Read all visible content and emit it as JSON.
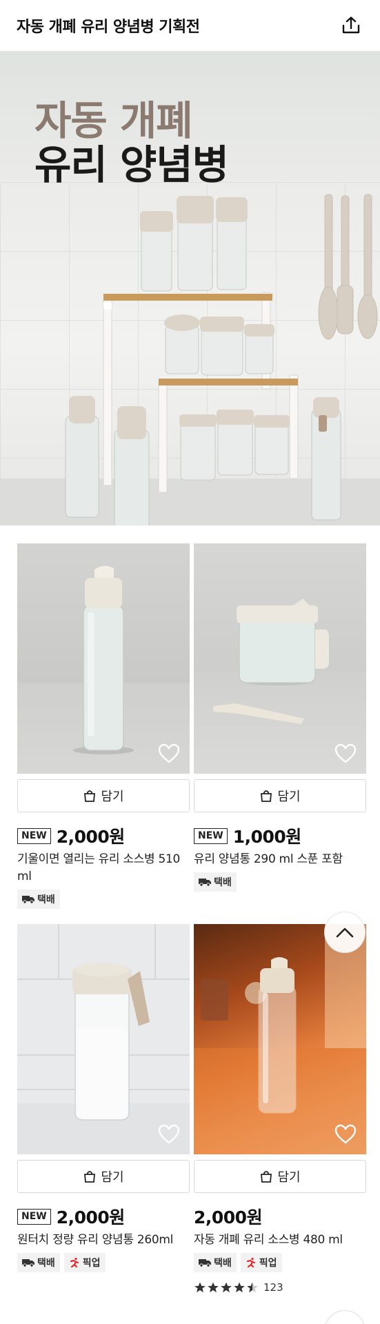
{
  "header": {
    "title": "자동 개폐 유리 양념병 기획전"
  },
  "hero": {
    "line1": "자동 개폐",
    "line2": "유리 양념병"
  },
  "labels": {
    "cart": "담기",
    "new": "NEW",
    "delivery": "택배",
    "pickup": "픽업"
  },
  "products": [
    {
      "price": "2,000원",
      "name": "기울이면 열리는 유리 소스병 510 ml",
      "is_new": true,
      "tags": [
        "택배"
      ]
    },
    {
      "price": "1,000원",
      "name": "유리 양념통 290 ml 스푼 포함",
      "is_new": true,
      "tags": [
        "택배"
      ]
    },
    {
      "price": "2,000원",
      "name": "원터치 정량 유리 양념통 260ml",
      "is_new": true,
      "tags": [
        "택배",
        "픽업"
      ]
    },
    {
      "price": "2,000원",
      "name": "자동 개폐 유리 소스병 480 ml",
      "is_new": false,
      "tags": [
        "택배",
        "픽업"
      ],
      "rating": 4.5,
      "review_count": "123"
    }
  ],
  "colors": {
    "accent_pickup": "#e4262b",
    "text": "#111111",
    "tag_bg": "#f2f2f2"
  },
  "icons": [
    "share-icon",
    "heart-icon",
    "shopping-bag-icon",
    "truck-icon",
    "pickup-runner-icon",
    "star-icon",
    "chevron-up-icon"
  ]
}
